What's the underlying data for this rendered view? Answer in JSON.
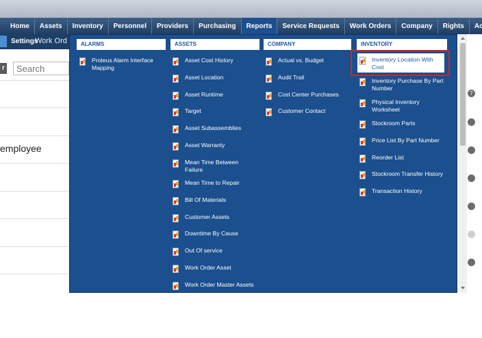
{
  "nav": {
    "items": [
      "Home",
      "Assets",
      "Inventory",
      "Personnel",
      "Providers",
      "Purchasing",
      "Reports",
      "Service Requests",
      "Work Orders",
      "Company",
      "Rights",
      "Active"
    ]
  },
  "sub": {
    "settings": "Settings",
    "work_orders": "Work Ord"
  },
  "background": {
    "button_text": "r",
    "search_placeholder": "Search",
    "employee_text": "employee",
    "badge_count": "7"
  },
  "menu": {
    "alarms": {
      "header": "ALARMS",
      "items": [
        "Proteus Alarm Interface Mapping"
      ]
    },
    "assets": {
      "header": "ASSETS",
      "items": [
        "Asset Cost History",
        "Asset Location",
        "Asset Runtime",
        "Target",
        "Asset Subassemblies",
        "Asset Warranty",
        "Mean Time Between Failure",
        "Mean Time to Repair",
        "Bill Of Materials",
        "Customer Assets",
        "Downtime By Cause",
        "Out Of service",
        "Work Order Asset",
        "Work Order Master Assets"
      ]
    },
    "company": {
      "header": "COMPANY",
      "items": [
        "Actual vs. Budget",
        "Audit Trail",
        "Cost Center Purchases",
        "Customer Contact"
      ]
    },
    "inventory": {
      "header": "INVENTORY",
      "items": [
        "Inventory Location With Cost",
        "Inventory Purchase By Part Number",
        "Physical Inventory Worksheet",
        "Stockroom Parts",
        "Price List By Part Number",
        "Reorder List",
        "Stockroom Transfer History",
        "Transaction History"
      ]
    }
  },
  "colors": {
    "nav_bg": "#1f3e64",
    "dropdown_bg": "#1b4f8d",
    "header_text": "#2257a0",
    "highlight_border": "#d2232a"
  }
}
